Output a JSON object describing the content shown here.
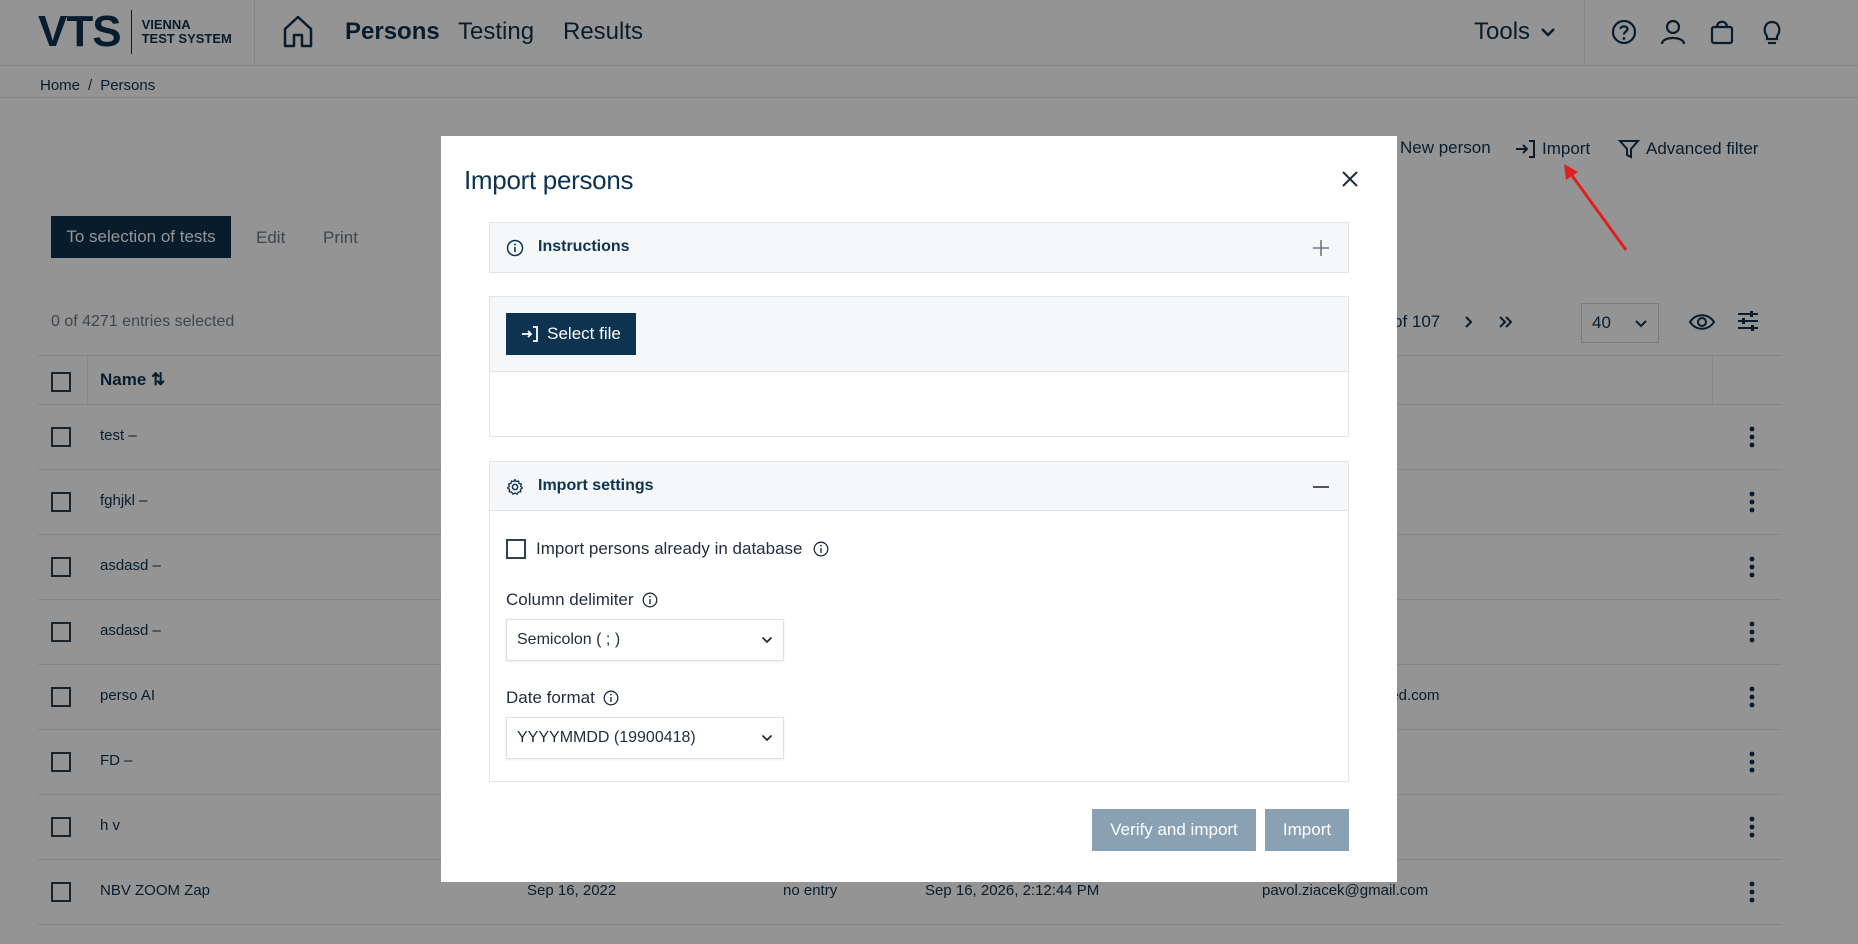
{
  "header": {
    "logo_mark": "VTS",
    "logo_line1": "VIENNA",
    "logo_line2": "TEST SYSTEM",
    "nav": [
      "Persons",
      "Testing",
      "Results"
    ],
    "tools_label": "Tools"
  },
  "breadcrumb": [
    "Home",
    "/",
    "Persons"
  ],
  "page": {
    "new_person": "New person",
    "import": "Import",
    "advanced_filter": "Advanced filter",
    "to_selection": "To selection of tests",
    "edit": "Edit",
    "print": "Print",
    "entries_selected": "0 of 4271 entries selected",
    "pager_text": "of 107",
    "per_page": "40",
    "table": {
      "name_header": "Name",
      "rows": [
        {
          "name": "test –",
          "date": "",
          "entry": "",
          "expiry": "",
          "email": ""
        },
        {
          "name": "fghjkl –",
          "date": "",
          "entry": "",
          "expiry": "",
          "email": ""
        },
        {
          "name": "asdasd –",
          "date": "",
          "entry": "",
          "expiry": "",
          "email": ""
        },
        {
          "name": "asdasd –",
          "date": "",
          "entry": "",
          "expiry": "",
          "email": ""
        },
        {
          "name": "perso AI",
          "date": "",
          "entry": "",
          "expiry": "",
          "email": "ried.com"
        },
        {
          "name": "FD –",
          "date": "",
          "entry": "",
          "expiry": "",
          "email": ""
        },
        {
          "name": "h v",
          "date": "",
          "entry": "",
          "expiry": "",
          "email": ""
        },
        {
          "name": "NBV ZOOM Zap",
          "date": "Sep 16, 2022",
          "entry": "no entry",
          "expiry": "Sep 16, 2026, 2:12:44 PM",
          "email": "pavol.ziacek@gmail.com"
        }
      ]
    }
  },
  "modal": {
    "title": "Import persons",
    "instructions_label": "Instructions",
    "select_file_label": "Select file",
    "settings_label": "Import settings",
    "already_in_db_label": "Import persons already in database",
    "column_delimiter_label": "Column delimiter",
    "column_delimiter_value": "Semicolon ( ; )",
    "date_format_label": "Date format",
    "date_format_value": "YYYYMMDD (19900418)",
    "verify_button": "Verify and import",
    "import_button": "Import"
  },
  "colors": {
    "brand": "#0d3350",
    "disabled_button": "#8aa0b3",
    "arrow": "#e02020"
  }
}
